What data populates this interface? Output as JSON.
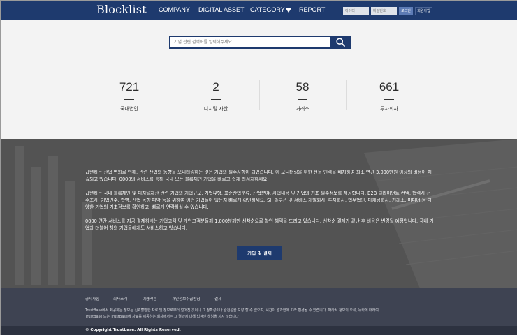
{
  "nav": {
    "logo": "Blocklist",
    "menu": [
      "COMPANY",
      "DIGITAL ASSET",
      "CATEGORY",
      "REPORT"
    ],
    "id_placeholder": "아이디",
    "pw_placeholder": "비밀번호",
    "login_label": "로그인",
    "join_label": "회원가입"
  },
  "search": {
    "placeholder": "기업 관련 검색어를 입력해주세요",
    "icon": "search-icon"
  },
  "stats": [
    {
      "value": "721",
      "label": "국내법인"
    },
    {
      "value": "2",
      "label": "디지털 자산"
    },
    {
      "value": "58",
      "label": "거래소"
    },
    {
      "value": "661",
      "label": "투자회사"
    }
  ],
  "info": {
    "p1": "급변하는 산업 변화로 인해, 관련 산업의 동향을 모니터링하는 것은 기업의 필수사항이 되었습니다. 이 모니터링을 위한 전문 인력을 배치하여 최소 연간 3,000만원 이상의 비용이 지출되고 있습니다. 0000의 서비스를 통해 국내 모든 블록체인 기업을 빠르고 쉽게 리서치하세요.",
    "p2": "급변하는 국내 블록체인 및 디지털자산 관련 기업의 기업규모, 기업유형, 표준산업분류, 산업분야, 사업내용 및 기업의 기초 필수정보를 제공합니다. B2B 클라이언트 컨택, 협력사 전수조사, 기업인수, 합병, 산업 동향 파악 등을 위하여 어떤 기업들이 있는지 빠르게 확인하세요. SI, 솔루션 및 서비스 개발회사, 투자회사, 법무법인, 마케팅회사, 거래소, 미디어 등 다양한 기업의 기초정보를 확인하고, 빠르게 연락하실 수 있습니다.",
    "p3": "0000 연간 서비스를 지금 결제하시는 기업고객 및 개인고객분들께 1,000분께만 선착순으로 할인 혜택을 드리고 있습니다. 선착순 결제가 끝난 후 비용은 변경될 예정입니다. 국내 기업과 더불어 해외 기업들에게도 서비스하고 있습니다.",
    "cta": "가입 및 결제"
  },
  "footer": {
    "links": [
      "공지사항",
      "회사소개",
      "이용약관",
      "개인정보취급방침",
      "결제"
    ],
    "desc1": "TrustBase에서 제공하는 정보는 신뢰할만한 자료 및 정보로부터 얻어진 것이나 그 정확성이나 완전성을 보장 할 수 없으며, 시간이 경과함에 따라 변경될 수 있습니다. 따라서 정보의 오류, 누락에 대하여",
    "desc2": "TrustBase 또는 TrustBase에 자료를 제공하는 회사에서는 그 결과에 대해 법적인 책임을 지지 않습니다",
    "copyright": "© Copyright Trustbase. All Rights Reserved."
  },
  "colors": {
    "navy": "#1e3a6e",
    "hero_bg": "#f3f3f3",
    "info_bg": "#585858",
    "footer_bg": "#3e4352"
  }
}
